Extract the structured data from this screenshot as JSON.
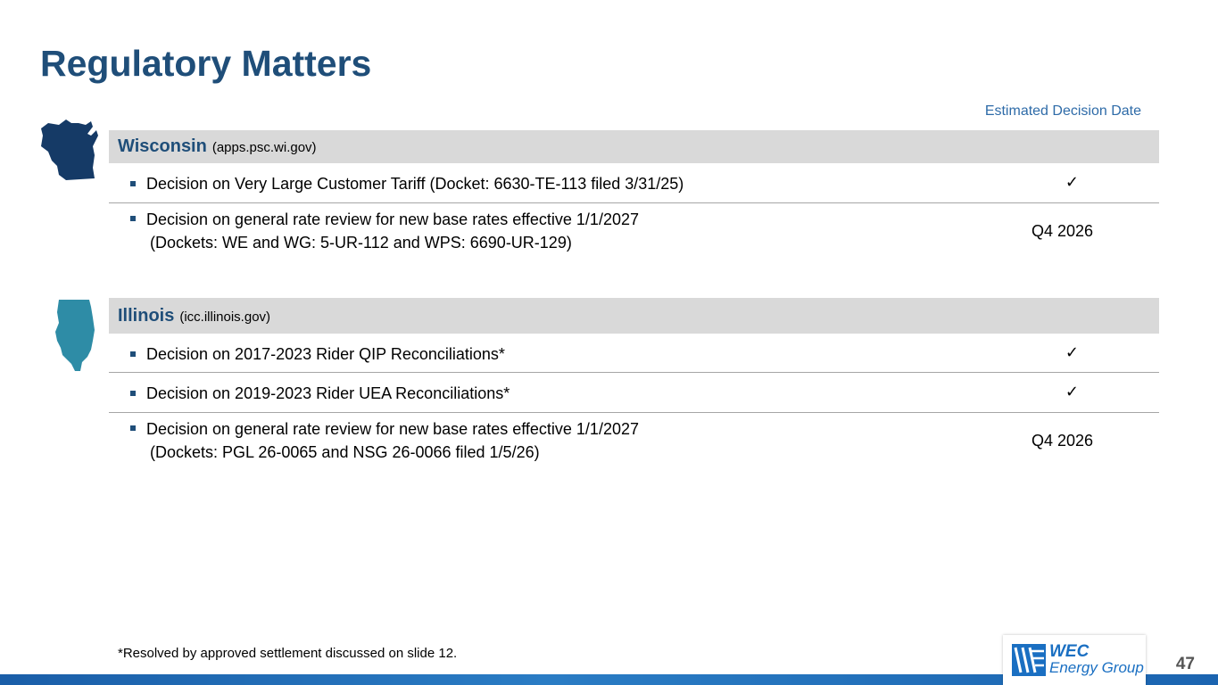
{
  "title": "Regulatory Matters",
  "column_header": "Estimated Decision Date",
  "wisconsin": {
    "name": "Wisconsin",
    "site": "(apps.psc.wi.gov)",
    "items": [
      {
        "line1": "Decision on Very Large Customer Tariff (Docket: 6630-TE-113 filed 3/31/25)",
        "line2": "",
        "status": "✓"
      },
      {
        "line1": "Decision on general rate review for new base rates effective 1/1/2027",
        "line2": "(Dockets: WE and WG: 5-UR-112 and WPS: 6690-UR-129)",
        "status": "Q4 2026"
      }
    ]
  },
  "illinois": {
    "name": "Illinois",
    "site": "(icc.illinois.gov)",
    "items": [
      {
        "line1": "Decision on 2017-2023 Rider QIP Reconciliations*",
        "line2": "",
        "status": "✓"
      },
      {
        "line1": "Decision on 2019-2023 Rider UEA Reconciliations*",
        "line2": "",
        "status": "✓"
      },
      {
        "line1": "Decision on general rate review for new base rates effective 1/1/2027",
        "line2": "(Dockets: PGL 26-0065 and NSG 26-0066 filed 1/5/26)",
        "status": "Q4 2026"
      }
    ]
  },
  "footnote": "*Resolved by approved settlement discussed on slide 12.",
  "logo": {
    "line1": "WEC",
    "line2": "Energy Group"
  },
  "page_number": "47",
  "icons": {
    "wisconsin_shape": "wisconsin-map-icon",
    "illinois_shape": "illinois-map-icon",
    "check": "checkmark-icon",
    "bullet": "square-bullet-icon"
  },
  "colors": {
    "title": "#1f4e79",
    "wisconsin_map": "#153a66",
    "illinois_map": "#2e8ca6",
    "section_bar": "#d9d9d9",
    "brand_blue": "#1a6fc2"
  }
}
